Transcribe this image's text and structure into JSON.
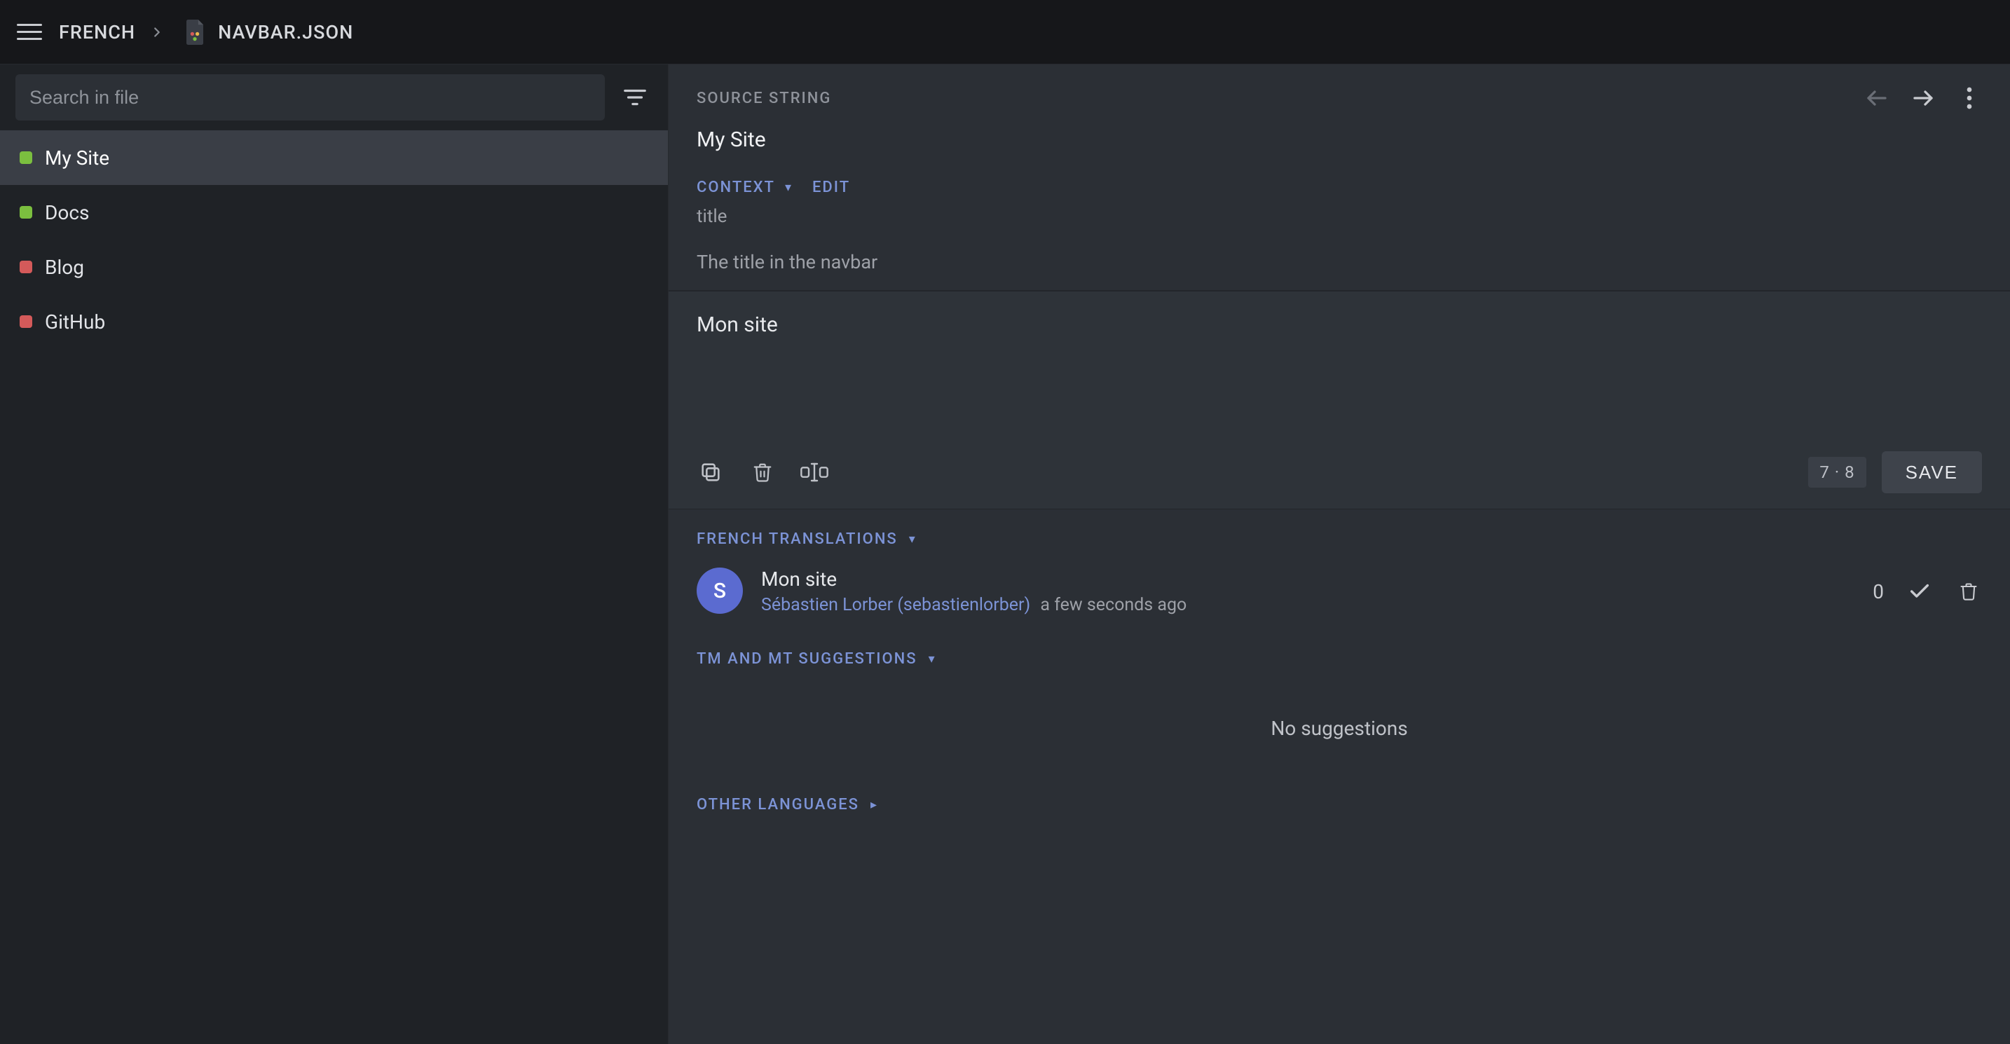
{
  "topbar": {
    "breadcrumb_language": "FRENCH",
    "breadcrumb_file": "NAVBAR.JSON"
  },
  "sidebar": {
    "search_placeholder": "Search in file",
    "items": [
      {
        "label": "My Site",
        "status": "green",
        "active": true
      },
      {
        "label": "Docs",
        "status": "green",
        "active": false
      },
      {
        "label": "Blog",
        "status": "red",
        "active": false
      },
      {
        "label": "GitHub",
        "status": "red",
        "active": false
      }
    ]
  },
  "source": {
    "section_label": "SOURCE STRING",
    "text": "My Site",
    "context_label": "CONTEXT",
    "edit_label": "EDIT",
    "context_key": "title",
    "context_description": "The title in the navbar"
  },
  "editor": {
    "value": "Mon site",
    "char_count": "7 · 8",
    "save_label": "SAVE"
  },
  "translations": {
    "header": "FRENCH TRANSLATIONS",
    "item": {
      "avatar_initial": "S",
      "text": "Mon site",
      "author": "Sébastien Lorber (sebastienlorber)",
      "time": "a few seconds ago",
      "score": "0"
    }
  },
  "tm": {
    "header": "TM AND MT SUGGESTIONS",
    "empty": "No suggestions"
  },
  "other_languages": {
    "header": "OTHER LANGUAGES"
  }
}
